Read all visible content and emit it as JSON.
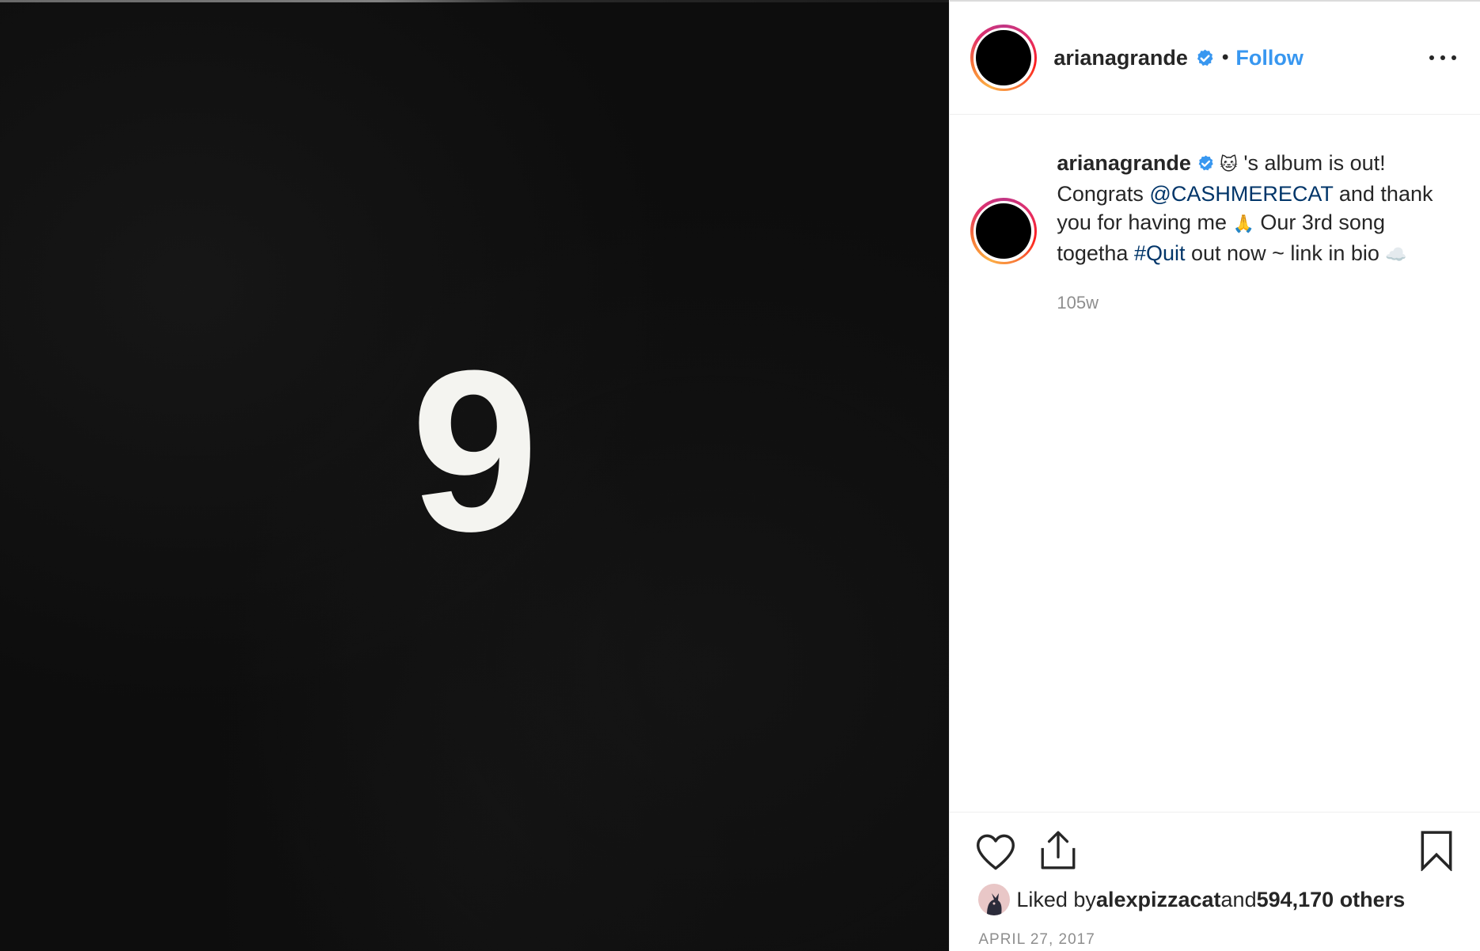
{
  "media": {
    "album_text": "9",
    "background_color": "#0d0d0d"
  },
  "header": {
    "username": "arianagrande",
    "separator": "•",
    "follow_label": "Follow",
    "more_icon": "more-options-icon"
  },
  "caption": {
    "username": "arianagrande",
    "emoji_cat": "🐱",
    "text_1": " 's album is out! Congrats ",
    "mention": "@CASHMERECAT",
    "text_2": " and thank you for having me ",
    "emoji_pray": "🙏",
    "text_3": "  Our 3rd song togetha ",
    "hashtag": "#Quit",
    "text_4": " out now ~ link in bio ",
    "emoji_cloud": "☁️",
    "time_ago": "105w"
  },
  "actions": {
    "like_icon": "heart-icon",
    "share_icon": "share-icon",
    "save_icon": "bookmark-icon"
  },
  "likes": {
    "prefix": "Liked by ",
    "liker": "alexpizzacat",
    "middle": " and ",
    "count_text": "594,170 others"
  },
  "post_date": "APRIL 27, 2017",
  "colors": {
    "link_blue": "#3897f0",
    "mention_blue": "#003569",
    "verified_blue": "#3897f0",
    "muted_gray": "#8e8e8e"
  }
}
